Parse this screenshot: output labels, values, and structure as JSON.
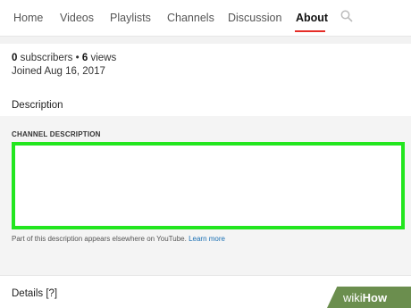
{
  "tabs": [
    "Home",
    "Videos",
    "Playlists",
    "Channels",
    "Discussion",
    "About"
  ],
  "active_tab": "About",
  "accent_color": "#e52d27",
  "highlight_color": "#22e61e",
  "search_icon": "search-icon",
  "stats": {
    "subscribers_count": "0",
    "subscribers_label": "subscribers",
    "separator": "•",
    "views_count": "6",
    "views_label": "views",
    "joined": "Joined Aug 16, 2017"
  },
  "description": {
    "section_title": "Description",
    "field_label": "CHANNEL DESCRIPTION",
    "value": "",
    "helper_text": "Part of this description appears elsewhere on YouTube.",
    "learn_more": "Learn more"
  },
  "details": {
    "title": "Details [?]"
  },
  "watermark": {
    "prefix": "wiki",
    "suffix": "How"
  }
}
